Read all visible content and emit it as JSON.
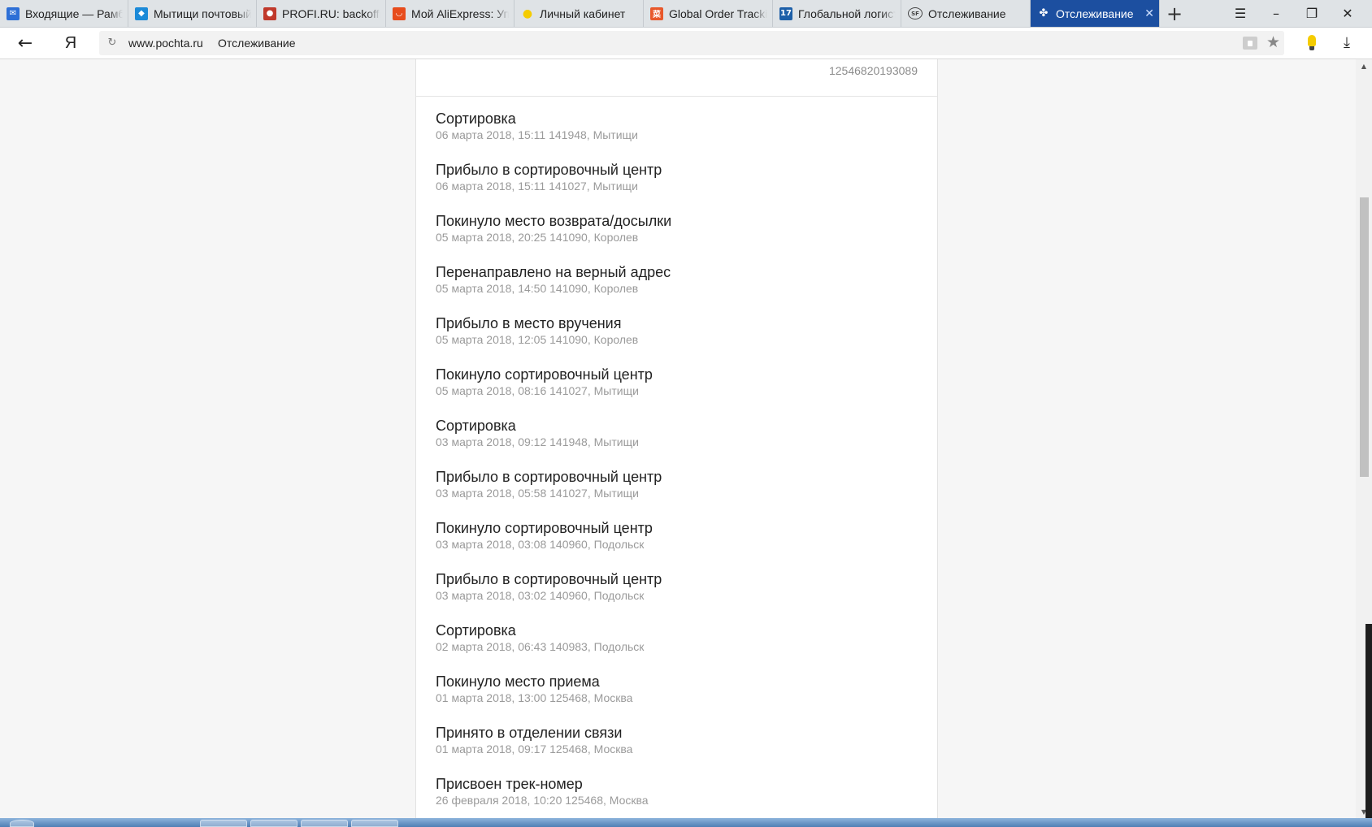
{
  "browser": {
    "tabs": [
      {
        "label": "Входящие — Рамблер",
        "icon": "mail-icon",
        "color": "#2d6fd6",
        "active": false
      },
      {
        "label": "Мытищи почтовый индекс",
        "icon": "cube-icon",
        "color": "#1b8ad8",
        "active": false
      },
      {
        "label": "PROFI.RU: backoffice",
        "icon": "profi-icon",
        "color": "#c0392b",
        "active": false
      },
      {
        "label": "Мой AliExpress: Управление",
        "icon": "aliexpress-icon",
        "color": "#e74c1c",
        "active": false
      },
      {
        "label": "Личный кабинет",
        "icon": "bulb-icon",
        "color": "#f5cc00",
        "active": false
      },
      {
        "label": "Global Order Tracking",
        "icon": "cainiao-icon",
        "color": "#e8582b",
        "active": false
      },
      {
        "label": "Глобальной логистики",
        "icon": "track17-icon",
        "color": "#1d5fa8",
        "active": false
      },
      {
        "label": "Отслеживание",
        "icon": "sf-icon",
        "color": "#555555",
        "active": false
      },
      {
        "label": "Отслеживание",
        "icon": "eagle-icon",
        "color": "#ffffff",
        "active": true
      }
    ],
    "address": {
      "domain": "www.pochta.ru",
      "title": "Отслеживание"
    }
  },
  "tracking": {
    "number": "12546820193089",
    "events": [
      {
        "title": "Сортировка",
        "meta": "06 марта 2018, 15:11 141948, Мытищи"
      },
      {
        "title": "Прибыло в сортировочный центр",
        "meta": "06 марта 2018, 15:11 141027, Мытищи"
      },
      {
        "title": "Покинуло место возврата/досылки",
        "meta": "05 марта 2018, 20:25 141090, Королев"
      },
      {
        "title": "Перенаправлено на верный адрес",
        "meta": "05 марта 2018, 14:50 141090, Королев"
      },
      {
        "title": "Прибыло в место вручения",
        "meta": "05 марта 2018, 12:05 141090, Королев"
      },
      {
        "title": "Покинуло сортировочный центр",
        "meta": "05 марта 2018, 08:16 141027, Мытищи"
      },
      {
        "title": "Сортировка",
        "meta": "03 марта 2018, 09:12 141948, Мытищи"
      },
      {
        "title": "Прибыло в сортировочный центр",
        "meta": "03 марта 2018, 05:58 141027, Мытищи"
      },
      {
        "title": "Покинуло сортировочный центр",
        "meta": "03 марта 2018, 03:08 140960, Подольск"
      },
      {
        "title": "Прибыло в сортировочный центр",
        "meta": "03 марта 2018, 03:02 140960, Подольск"
      },
      {
        "title": "Сортировка",
        "meta": "02 марта 2018, 06:43 140983, Подольск"
      },
      {
        "title": "Покинуло место приема",
        "meta": "01 марта 2018, 13:00 125468, Москва"
      },
      {
        "title": "Принято в отделении связи",
        "meta": "01 марта 2018, 09:17 125468, Москва"
      },
      {
        "title": "Присвоен трек-номер",
        "meta": "26 февраля 2018, 10:20 125468, Москва"
      }
    ]
  }
}
